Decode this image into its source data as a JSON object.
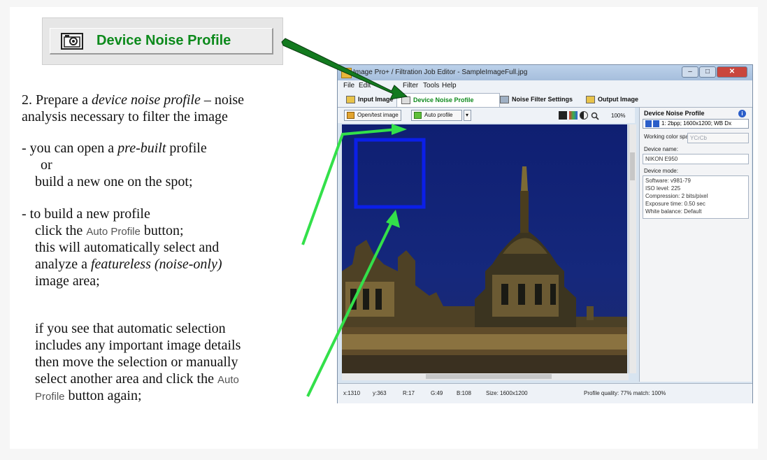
{
  "callout": {
    "button_label": "Device Noise Profile",
    "icon": "camera-icon"
  },
  "instructions": {
    "step_prefix": "2. Prepare a ",
    "step_term": "device noise profile",
    "step_suffix": " – noise",
    "step_line2": "analysis necessary to filter the image",
    "b1_prefix": "-  you can open a ",
    "b1_term": "pre-built",
    "b1_suffix": " profile",
    "b1_or": "or",
    "b1_line3": "build a new one on the spot;",
    "b2_line1": "-  to build a new profile",
    "b2_click": "click the ",
    "b2_ref": "Auto Profile",
    "b2_button": " button;",
    "b2_line3": "this will automatically select and",
    "b2_analyze": "analyze a ",
    "b2_term": "featureless (noise-only)",
    "b2_line5": "image area;",
    "b3_line1": "if you see that automatic selection",
    "b3_line2": "includes any important image details",
    "b3_line3": "then move the selection  or manually",
    "b3_line4": "select another area and click the ",
    "b3_ref1": "Auto",
    "b3_ref2": "Profile",
    "b3_line5": " button again;"
  },
  "window": {
    "title": "Image Pro+ / Filtration Job Editor - SampleImageFull.jpg",
    "menu": [
      "File",
      "Edit",
      "Filter",
      "Tools",
      "Help"
    ],
    "tabs": [
      "Input Image",
      "Device Noise Profile",
      "Noise Filter Settings",
      "Output Image"
    ],
    "toolbar": {
      "open_button": "Open/test image",
      "auto_profile_button": "Auto profile",
      "zoom": "100%"
    },
    "side": {
      "title": "Device Noise Profile",
      "profile_value": "1: 2bpp; 1600x1200; WB Dx",
      "color_space_label": "Working color space:",
      "color_space_value": "YCrCb",
      "device_name_label": "Device name:",
      "device_name_value": "NIKON E950",
      "device_mode_label": "Device mode:",
      "device_mode_lines": [
        "Software: v981-79",
        "ISO level: 225",
        "Compression: 2 bits/pixel",
        "Exposure time: 0.50 sec",
        "White balance: Default"
      ]
    },
    "status": {
      "x": "x:1310",
      "y": "y:363",
      "r": "R:17",
      "g": "G:49",
      "b": "B:108",
      "size": "Size: 1600x1200",
      "quality": "Profile quality: 77%  match: 100%"
    }
  },
  "colors": {
    "accent_green": "#0d8a1c",
    "arrow_green": "#33e04a",
    "arrow_dark_green": "#137a1f",
    "selection_blue": "#0b1fe8",
    "sky_blue": "#15287c"
  }
}
